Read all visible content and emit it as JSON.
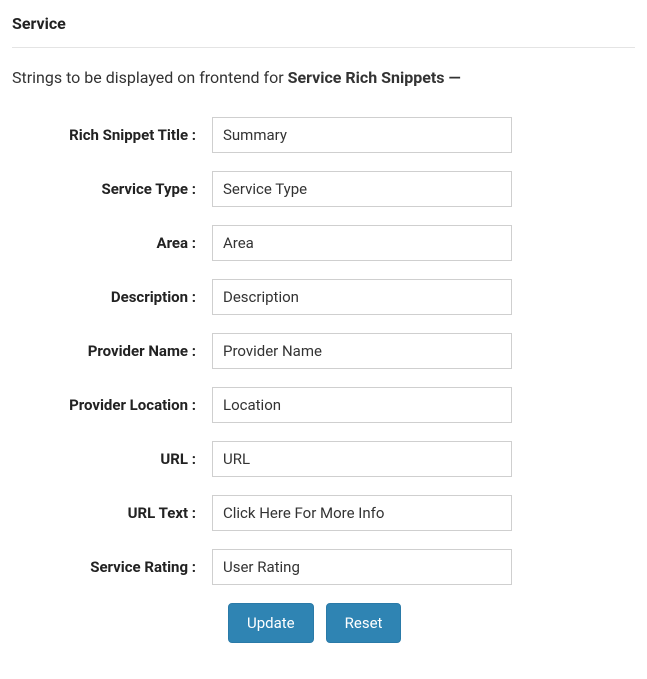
{
  "section": {
    "title": "Service"
  },
  "intro": {
    "prefix": "Strings to be displayed on frontend for ",
    "bold": "Service Rich Snippets —"
  },
  "fields": {
    "rich_snippet_title": {
      "label": "Rich Snippet Title :",
      "value": "Summary"
    },
    "service_type": {
      "label": "Service Type :",
      "value": "Service Type"
    },
    "area": {
      "label": "Area :",
      "value": "Area"
    },
    "description": {
      "label": "Description :",
      "value": "Description"
    },
    "provider_name": {
      "label": "Provider Name :",
      "value": "Provider Name"
    },
    "provider_location": {
      "label": "Provider Location :",
      "value": "Location"
    },
    "url": {
      "label": "URL :",
      "value": "URL"
    },
    "url_text": {
      "label": "URL Text :",
      "value": "Click Here For More Info"
    },
    "service_rating": {
      "label": "Service Rating :",
      "value": "User Rating"
    }
  },
  "buttons": {
    "update": "Update",
    "reset": "Reset"
  }
}
